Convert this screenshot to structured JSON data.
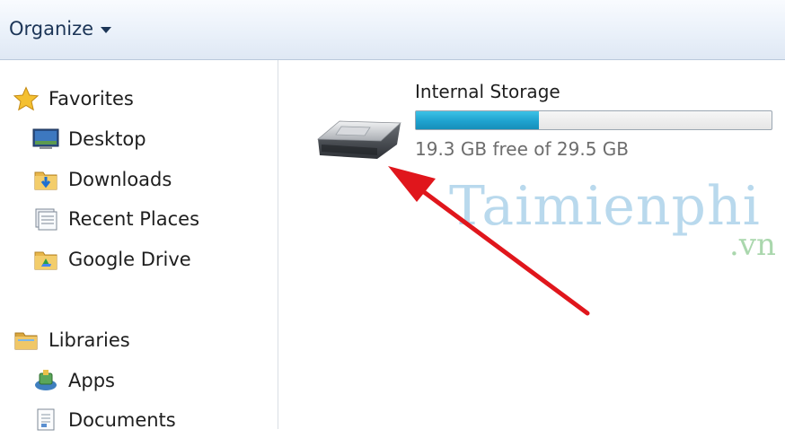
{
  "toolbar": {
    "organize_label": "Organize"
  },
  "nav": {
    "favorites": {
      "label": "Favorites",
      "items": [
        {
          "label": "Desktop",
          "icon": "desktop-icon"
        },
        {
          "label": "Downloads",
          "icon": "downloads-folder-icon"
        },
        {
          "label": "Recent Places",
          "icon": "recent-places-icon"
        },
        {
          "label": "Google Drive",
          "icon": "google-drive-folder-icon"
        }
      ]
    },
    "libraries": {
      "label": "Libraries",
      "items": [
        {
          "label": "Apps",
          "icon": "apps-icon"
        },
        {
          "label": "Documents",
          "icon": "documents-icon"
        }
      ]
    }
  },
  "drive": {
    "name": "Internal Storage",
    "free_text": "19.3 GB free of 29.5 GB",
    "used_fraction": 0.346,
    "icon": "usb-drive-icon"
  },
  "watermark": {
    "main": "Taimienphi",
    "sub": ".vn"
  },
  "colors": {
    "bar_fill": "#1fa2cf",
    "arrow": "#e0161c",
    "toolbar_text": "#1c3557"
  }
}
